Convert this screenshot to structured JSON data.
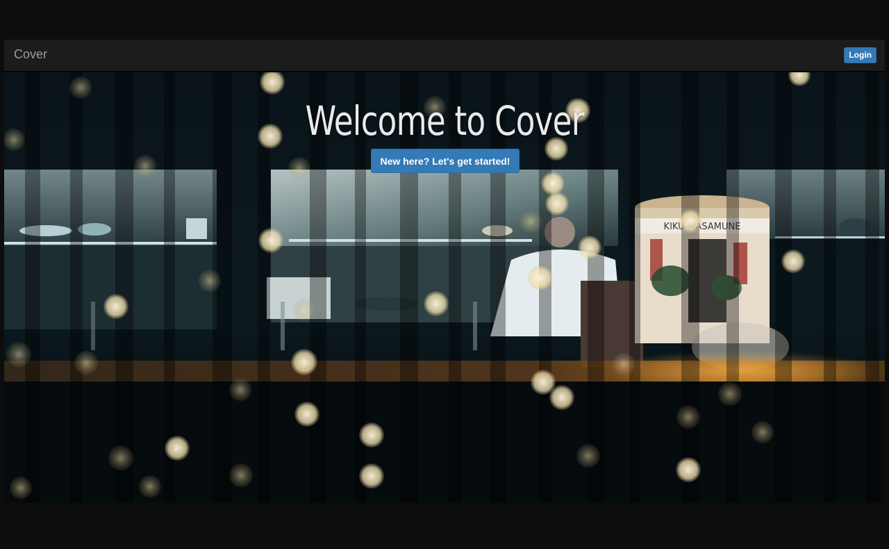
{
  "navbar": {
    "brand": "Cover",
    "login_label": "Login"
  },
  "hero": {
    "title": "Welcome to Cover",
    "cta_label": "New here? Let's get started!",
    "sign_text": "KIKU-MASAMUNE"
  },
  "colors": {
    "page_bg": "#0d0d0d",
    "navbar_bg": "#1c1c1c",
    "brand_text": "#9d9d9d",
    "button_primary": "#337ab7"
  }
}
